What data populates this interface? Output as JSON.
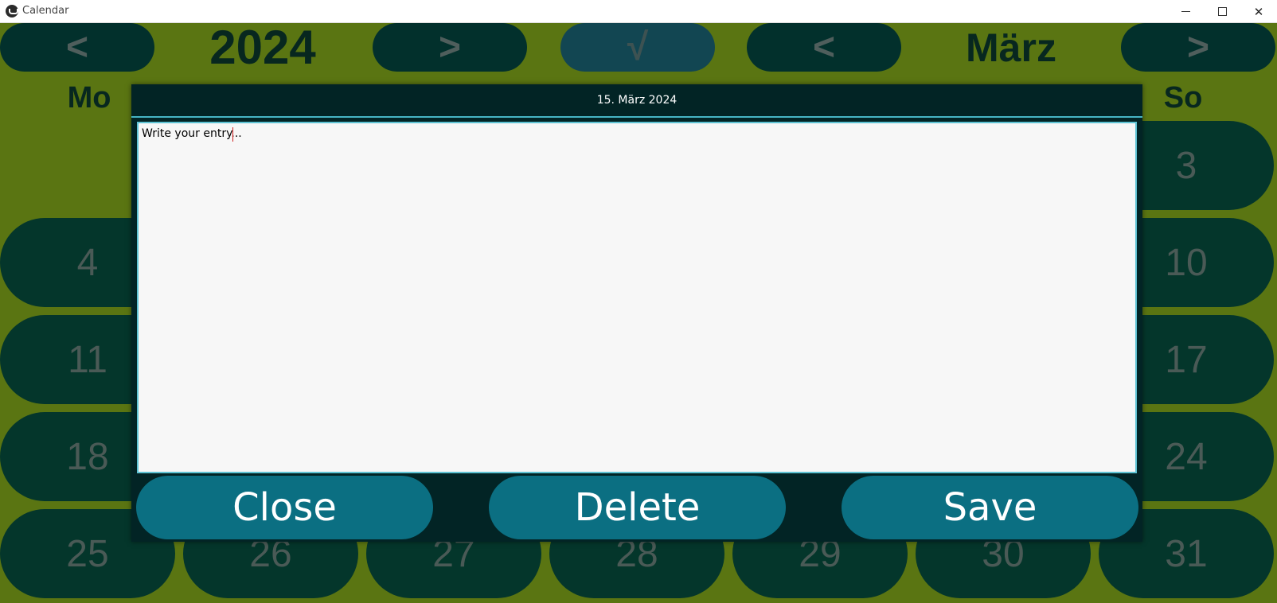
{
  "window": {
    "title": "Calendar",
    "minimize": "",
    "maximize": "",
    "close": "✕"
  },
  "calendar": {
    "year_prev": "<",
    "year": "2024",
    "year_next": ">",
    "today": "√",
    "month_prev": "<",
    "month": "März",
    "month_next": ">",
    "weekdays": {
      "mo": "Mo",
      "so": "So"
    },
    "days": {
      "d3": "3",
      "d4": "4",
      "d10": "10",
      "d11": "11",
      "d17": "17",
      "d18": "18",
      "d24": "24",
      "d25": "25",
      "d26": "26",
      "d27": "27",
      "d28": "28",
      "d29": "29",
      "d30": "30",
      "d31": "31"
    }
  },
  "dialog": {
    "title": "15. März 2024",
    "entry_text": "Write your entry...",
    "close_label": "Close",
    "delete_label": "Delete",
    "save_label": "Save"
  },
  "colors": {
    "background": "#5a7512",
    "pill_dark": "#02302c",
    "day_pill": "#04362b",
    "dialog_bg": "#022425",
    "accent": "#46b4c4",
    "button": "#0b6f82"
  }
}
